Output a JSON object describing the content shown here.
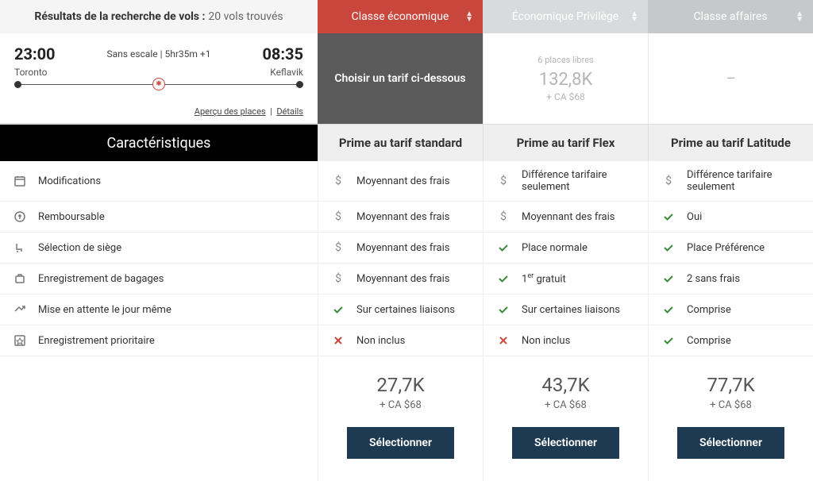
{
  "header": {
    "results_label": "Résultats de la recherche de vols :",
    "results_count": "20 vols trouvés",
    "cabins": [
      {
        "label": "Classe économique",
        "style": "red"
      },
      {
        "label": "Économique Privilège",
        "style": "dim"
      },
      {
        "label": "Classe affaires",
        "style": "dim2"
      }
    ]
  },
  "flight": {
    "dep_time": "23:00",
    "arr_time": "08:35",
    "info": "Sans escale | 5hr35m +1",
    "dep_city": "Toronto",
    "arr_city": "Keflavik",
    "seat_preview": "Aperçu des places",
    "details": "Détails",
    "logo_glyph": "✱"
  },
  "promo": {
    "choose_label": "Choisir un tarif ci-dessous",
    "seats_left": "6 places libres",
    "points": "132,8K",
    "tax": "+ CA $68",
    "dash": "—"
  },
  "features_header": "Caractéristiques",
  "fare_headers": [
    "Prime au tarif standard",
    "Prime au tarif Flex",
    "Prime au tarif Latitude"
  ],
  "features": [
    {
      "icon": "calendar",
      "label": "Modifications",
      "vals": [
        {
          "k": "dollar",
          "t": "Moyennant des frais"
        },
        {
          "k": "dollar",
          "t": "Différence tarifaire seulement"
        },
        {
          "k": "dollar",
          "t": "Différence tarifaire seulement"
        }
      ]
    },
    {
      "icon": "refund",
      "label": "Remboursable",
      "vals": [
        {
          "k": "dollar",
          "t": "Moyennant des frais"
        },
        {
          "k": "dollar",
          "t": "Moyennant des frais"
        },
        {
          "k": "check",
          "t": "Oui"
        }
      ]
    },
    {
      "icon": "seat",
      "label": "Sélection de siège",
      "vals": [
        {
          "k": "dollar",
          "t": "Moyennant des frais"
        },
        {
          "k": "check",
          "t": "Place normale"
        },
        {
          "k": "check",
          "t": "Place Préférence"
        }
      ]
    },
    {
      "icon": "bag",
      "label": "Enregistrement de bagages",
      "vals": [
        {
          "k": "dollar",
          "t": "Moyennant des frais"
        },
        {
          "k": "check",
          "t": "1er gratuit",
          "html": "1<sup>er</sup> gratuit"
        },
        {
          "k": "check",
          "t": "2 sans frais"
        }
      ]
    },
    {
      "icon": "standby",
      "label": "Mise en attente le jour même",
      "vals": [
        {
          "k": "check",
          "t": "Sur certaines liaisons"
        },
        {
          "k": "check",
          "t": "Sur certaines liaisons"
        },
        {
          "k": "check",
          "t": "Comprise"
        }
      ]
    },
    {
      "icon": "priority",
      "label": "Enregistrement prioritaire",
      "vals": [
        {
          "k": "cross",
          "t": "Non inclus"
        },
        {
          "k": "cross",
          "t": "Non inclus"
        },
        {
          "k": "check",
          "t": "Comprise"
        }
      ]
    }
  ],
  "fares": [
    {
      "points": "27,7K",
      "tax": "+ CA $68",
      "btn": "Sélectionner"
    },
    {
      "points": "43,7K",
      "tax": "+ CA $68",
      "btn": "Sélectionner"
    },
    {
      "points": "77,7K",
      "tax": "+ CA $68",
      "btn": "Sélectionner"
    }
  ]
}
